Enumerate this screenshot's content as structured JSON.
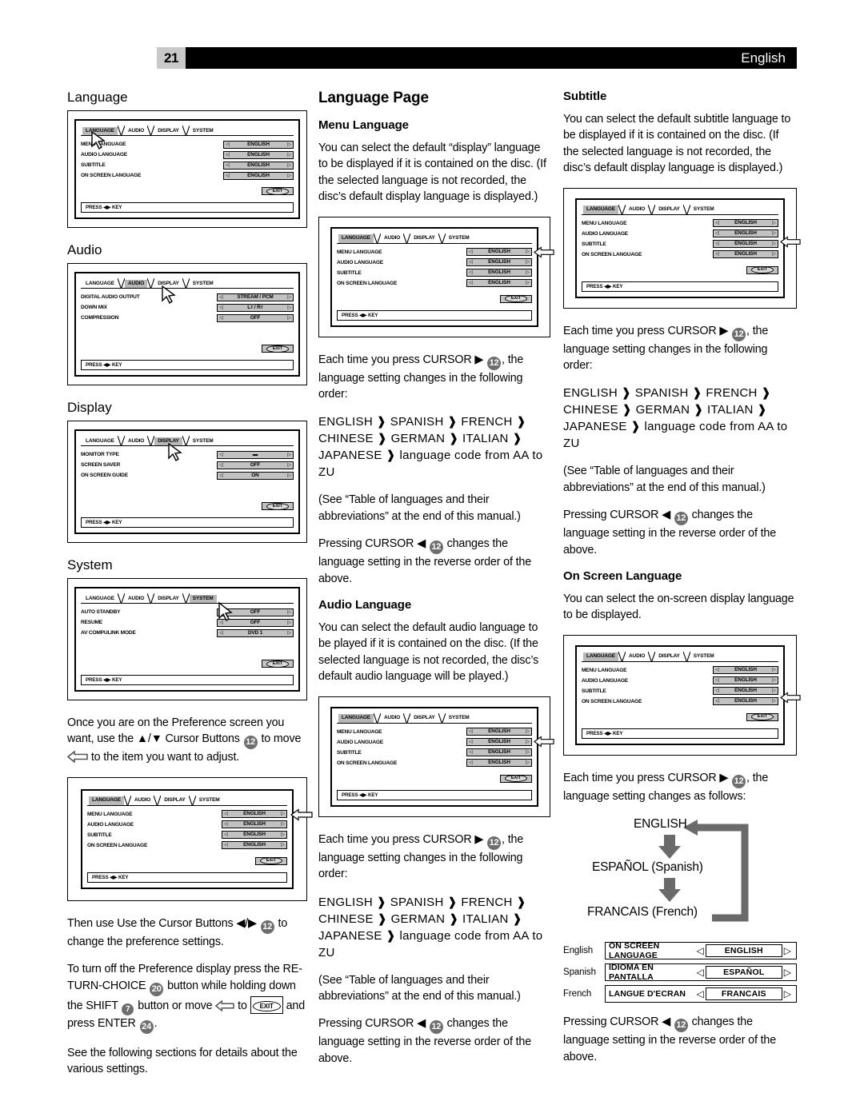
{
  "header": {
    "page_number": "21",
    "language_label": "English"
  },
  "osd_common": {
    "tabs": [
      "LANGUAGE",
      "AUDIO",
      "DISPLAY",
      "SYSTEM"
    ],
    "exit_label": "EXIT",
    "press_key_label": "PRESS ◀▶ KEY"
  },
  "left_column": {
    "sections": [
      {
        "heading": "Language",
        "osd": {
          "selected_tab": "LANGUAGE",
          "rows": [
            {
              "label": "MENU LANGUAGE",
              "value": "ENGLISH"
            },
            {
              "label": "AUDIO LANGUAGE",
              "value": "ENGLISH"
            },
            {
              "label": "SUBTITLE",
              "value": "ENGLISH"
            },
            {
              "label": "ON SCREEN LANGUAGE",
              "value": "ENGLISH"
            }
          ]
        }
      },
      {
        "heading": "Audio",
        "osd": {
          "selected_tab": "AUDIO",
          "rows": [
            {
              "label": "DIGITAL AUDIO OUTPUT",
              "value": "STREAM / PCM"
            },
            {
              "label": "DOWN MIX",
              "value": "Lт / Rт"
            },
            {
              "label": "COMPRESSION",
              "value": "OFF"
            }
          ]
        }
      },
      {
        "heading": "Display",
        "osd": {
          "selected_tab": "DISPLAY",
          "rows": [
            {
              "label": "MONITOR TYPE",
              "value": "▬"
            },
            {
              "label": "SCREEN SAVER",
              "value": "OFF"
            },
            {
              "label": "ON SCREEN GUIDE",
              "value": "ON"
            }
          ]
        }
      },
      {
        "heading": "System",
        "osd": {
          "selected_tab": "SYSTEM",
          "rows": [
            {
              "label": "AUTO STANDBY",
              "value": "OFF"
            },
            {
              "label": "RESUME",
              "value": "OFF"
            },
            {
              "label": "AV COMPULINK MODE",
              "value": "DVD 1"
            }
          ]
        }
      }
    ],
    "para_preference_1": "Once you are on the Preference screen you want, use the ▲/▼ Cursor Buttons",
    "para_preference_1b": "to move",
    "para_preference_1c": "to the item you want to adjust.",
    "badge_cursor": "12",
    "osd_preference": {
      "selected_tab": "LANGUAGE",
      "rows": [
        {
          "label": "MENU LANGUAGE",
          "value": "ENGLISH"
        },
        {
          "label": "AUDIO LANGUAGE",
          "value": "ENGLISH"
        },
        {
          "label": "SUBTITLE",
          "value": "ENGLISH"
        },
        {
          "label": "ON SCREEN LANGUAGE",
          "value": "ENGLISH"
        }
      ]
    },
    "para_then_use_a": "Then use Use the Cursor Buttons ◀/▶",
    "para_then_use_b": "to change the preference settings.",
    "para_turnoff_a": "To turn off the Preference display press the RE-TURN-CHOICE",
    "badge_return": "20",
    "para_turnoff_b": "button while holding down the SHIFT",
    "badge_shift": "7",
    "para_turnoff_c": "button or move",
    "para_turnoff_d": "to",
    "exit_inline_label": "EXIT",
    "para_turnoff_e": "and press ENTER",
    "badge_enter": "24",
    "para_turnoff_f": ".",
    "para_see_following": "See the following sections for details about the various settings."
  },
  "mid_column": {
    "title": "Language Page",
    "menu_language": {
      "heading": "Menu Language",
      "body": "You can select the default “display” language to be displayed if it is contained on the disc. (If the selected language is not recorded, the disc’s default display language is displayed.)",
      "osd": {
        "selected_tab": "LANGUAGE",
        "highlight_row": 0,
        "rows": [
          {
            "label": "MENU LANGUAGE",
            "value": "ENGLISH"
          },
          {
            "label": "AUDIO LANGUAGE",
            "value": "ENGLISH"
          },
          {
            "label": "SUBTITLE",
            "value": "ENGLISH"
          },
          {
            "label": "ON SCREEN LANGUAGE",
            "value": "ENGLISH"
          }
        ]
      },
      "each_time_a": "Each time you press CURSOR ▶",
      "each_time_b": ", the language setting changes in the following order:",
      "sequence": "ENGLISH ❱ SPANISH ❱ FRENCH ❱ CHINESE ❱ GERMAN ❱ ITALIAN ❱ JAPANESE ❱ language code from AA to ZU",
      "see_table": "(See “Table of languages and their abbreviations” at the end of this manual.)",
      "pressing_a": "Pressing CURSOR ◀",
      "pressing_b": "changes the language setting in the reverse order of the above."
    },
    "audio_language": {
      "heading": "Audio Language",
      "body": "You can select the default audio language to be played if it is contained on the disc. (If the selected language is not recorded, the disc’s default audio language will be played.)",
      "osd": {
        "selected_tab": "LANGUAGE",
        "highlight_row": 1,
        "rows": [
          {
            "label": "MENU LANGUAGE",
            "value": "ENGLISH"
          },
          {
            "label": "AUDIO LANGUAGE",
            "value": "ENGLISH"
          },
          {
            "label": "SUBTITLE",
            "value": "ENGLISH"
          },
          {
            "label": "ON SCREEN LANGUAGE",
            "value": "ENGLISH"
          }
        ]
      },
      "each_time_a": "Each time you press CURSOR ▶",
      "each_time_b": ", the language setting changes in the following order:",
      "sequence": "ENGLISH ❱ SPANISH ❱ FRENCH ❱ CHINESE ❱ GERMAN ❱ ITALIAN ❱ JAPANESE ❱ language code from AA to ZU",
      "see_table": "(See “Table of languages and their abbreviations” at the end of this manual.)",
      "pressing_a": "Pressing CURSOR ◀",
      "pressing_b": "changes the language setting in the reverse order of the above."
    },
    "badge_cursor": "12"
  },
  "right_column": {
    "subtitle": {
      "heading": "Subtitle",
      "body": "You can select the default subtitle language to be displayed if it is contained on the disc. (If the selected language is not recorded, the disc’s default display language is displayed.)",
      "osd": {
        "selected_tab": "LANGUAGE",
        "highlight_row": 2,
        "rows": [
          {
            "label": "MENU LANGUAGE",
            "value": "ENGLISH"
          },
          {
            "label": "AUDIO LANGUAGE",
            "value": "ENGLISH"
          },
          {
            "label": "SUBTITLE",
            "value": "ENGLISH"
          },
          {
            "label": "ON SCREEN LANGUAGE",
            "value": "ENGLISH"
          }
        ]
      },
      "each_time_a": "Each time you press CURSOR ▶",
      "each_time_b": ", the language setting changes in the following order:",
      "sequence": "ENGLISH ❱ SPANISH ❱ FRENCH ❱ CHINESE ❱ GERMAN ❱ ITALIAN ❱ JAPANESE ❱ language code from AA to ZU",
      "see_table": "(See “Table of languages and their abbreviations” at the end of this manual.)",
      "pressing_a": "Pressing CURSOR ◀",
      "pressing_b": "changes the language setting in the reverse order of the above."
    },
    "on_screen_language": {
      "heading": "On Screen Language",
      "body": "You can select the on-screen display language to be displayed.",
      "osd": {
        "selected_tab": "LANGUAGE",
        "highlight_row": 3,
        "rows": [
          {
            "label": "MENU LANGUAGE",
            "value": "ENGLISH"
          },
          {
            "label": "AUDIO LANGUAGE",
            "value": "ENGLISH"
          },
          {
            "label": "SUBTITLE",
            "value": "ENGLISH"
          },
          {
            "label": "ON SCREEN LANGUAGE",
            "value": "ENGLISH"
          }
        ]
      },
      "each_time_a": "Each time you press CURSOR ▶",
      "each_time_b": ", the language setting changes as follows:",
      "cycle": [
        "ENGLISH",
        "ESPAÑOL (Spanish)",
        "FRANCAIS (French)"
      ],
      "table": [
        {
          "lang": "English",
          "label": "ON SCREEN LANGUAGE",
          "value": "ENGLISH"
        },
        {
          "lang": "Spanish",
          "label": "IDIOMA EN PANTALLA",
          "value": "ESPAÑOL"
        },
        {
          "lang": "French",
          "label": "LANGUE D'ECRAN",
          "value": "FRANCAIS"
        }
      ],
      "pressing_a": "Pressing CURSOR ◀",
      "pressing_b": "changes the language setting in the reverse order of the above."
    },
    "badge_cursor": "12"
  }
}
